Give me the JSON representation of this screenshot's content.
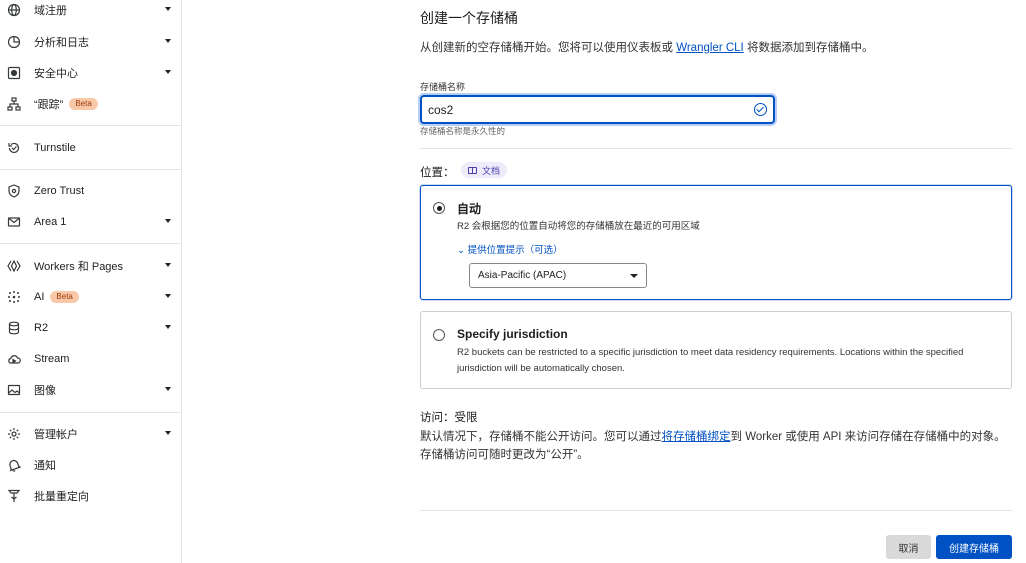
{
  "sidebar": {
    "items": [
      {
        "label": "域注册",
        "icon": "globe-icon",
        "expandable": true
      },
      {
        "label": "分析和日志",
        "icon": "chart-icon",
        "expandable": true
      },
      {
        "label": "安全中心",
        "icon": "security-center-icon",
        "expandable": true
      },
      {
        "label": "“跟踪”",
        "icon": "sitemap-icon",
        "expandable": false,
        "badge": "Beta"
      },
      {
        "label": "Turnstile",
        "icon": "turnstile-icon",
        "expandable": false
      },
      {
        "label": "Zero Trust",
        "icon": "shield-icon",
        "expandable": false
      },
      {
        "label": "Area 1",
        "icon": "mail-icon",
        "expandable": true
      },
      {
        "label": "Workers 和 Pages",
        "icon": "workers-icon",
        "expandable": true
      },
      {
        "label": "AI",
        "icon": "ai-sparkle-icon",
        "expandable": true,
        "badge": "Beta"
      },
      {
        "label": "R2",
        "icon": "database-icon",
        "expandable": true
      },
      {
        "label": "Stream",
        "icon": "cloud-icon",
        "expandable": false
      },
      {
        "label": "图像",
        "icon": "image-icon",
        "expandable": true
      },
      {
        "label": "管理帐户",
        "icon": "gear-icon",
        "expandable": true
      },
      {
        "label": "通知",
        "icon": "bell-icon",
        "expandable": false
      },
      {
        "label": "批量重定向",
        "icon": "redirect-icon",
        "expandable": false
      }
    ]
  },
  "main": {
    "title": "创建一个存储桶",
    "subtitle_before": "从创建新的空存储桶开始。您将可以使用仪表板或 ",
    "subtitle_link": "Wrangler CLI",
    "subtitle_after": " 将数据添加到存储桶中。",
    "name_label": "存储桶名称",
    "name_value": "cos2",
    "name_hint": "存储桶名称是永久性的",
    "location_label": "位置：",
    "docs_label": "文档",
    "auto": {
      "title": "自动",
      "desc": "R2 会根据您的位置自动将您的存储桶放在最近的可用区域",
      "hint_toggle": "提供位置提示（可选）",
      "select_value": "Asia-Pacific (APAC)",
      "selected": true
    },
    "jurisdiction": {
      "title": "Specify jurisdiction",
      "desc": "R2 buckets can be restricted to a specific jurisdiction to meet data residency requirements. Locations within the specified jurisdiction will be automatically chosen.",
      "selected": false
    },
    "access_label": "访问：",
    "access_value": "受限",
    "access_before": "默认情况下，存储桶不能公开访问。您可以通过",
    "access_link": "将存储桶绑定",
    "access_after": "到 Worker 或使用 API 来访问存储在存储桶中的对象。存储桶访问可随时更改为“公开”。",
    "cancel_label": "取消",
    "create_label": "创建存储桶"
  },
  "colors": {
    "accent": "#0051c3",
    "badge_bg": "#f9c8a8",
    "docs_chip_bg": "#eeecfb"
  }
}
